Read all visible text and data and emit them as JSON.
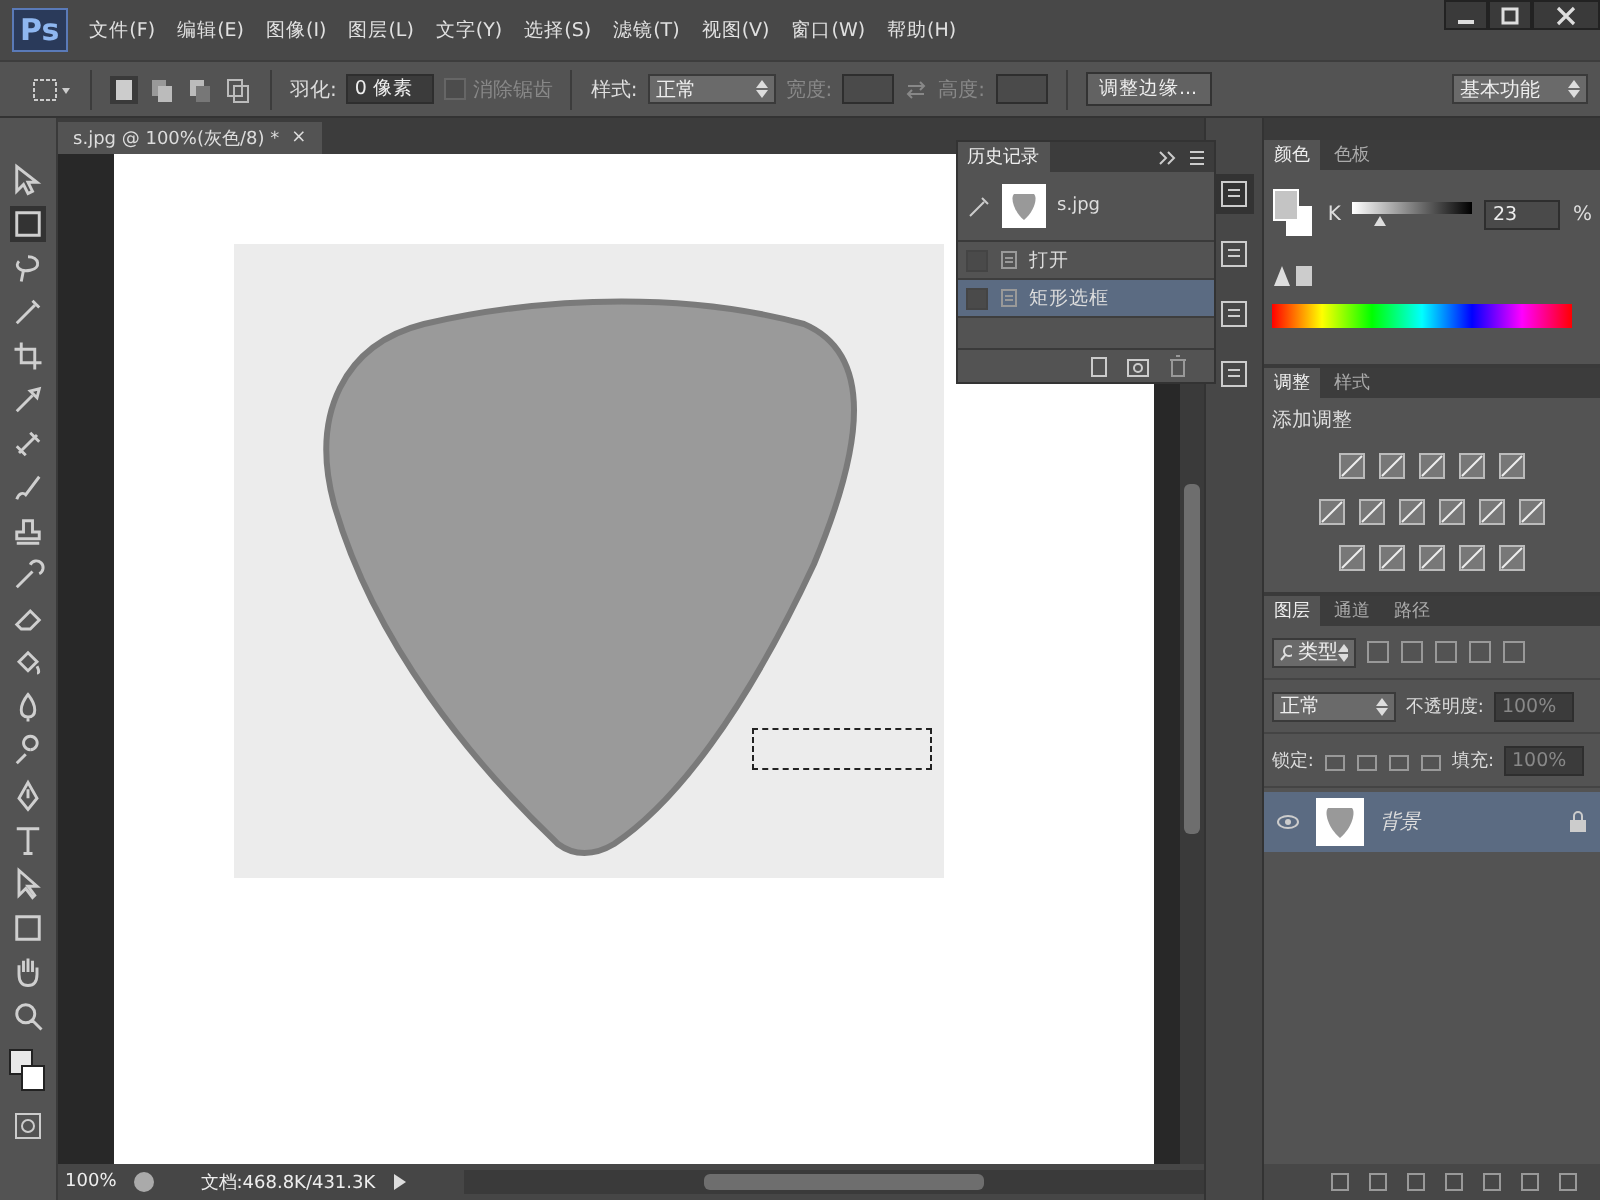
{
  "app": {
    "logo": "Ps"
  },
  "menu": [
    "文件(F)",
    "编辑(E)",
    "图像(I)",
    "图层(L)",
    "文字(Y)",
    "选择(S)",
    "滤镜(T)",
    "视图(V)",
    "窗口(W)",
    "帮助(H)"
  ],
  "options_bar": {
    "feather_label": "羽化:",
    "feather_value": "0 像素",
    "antialias": {
      "label": "消除锯齿",
      "disabled": true
    },
    "style_label": "样式:",
    "style_value": "正常",
    "width_label": "宽度:",
    "height_label": "高度:",
    "refine_button": "调整边缘...",
    "workspace": "基本功能"
  },
  "document_tab": {
    "title": "s.jpg @ 100%(灰色/8) *",
    "close": "×"
  },
  "history_panel": {
    "title": "历史记录",
    "snapshot": "s.jpg",
    "items": [
      {
        "label": "打开",
        "selected": false
      },
      {
        "label": "矩形选框",
        "selected": true
      }
    ]
  },
  "color_panel": {
    "tabs": [
      {
        "label": "颜色",
        "selected": true
      },
      {
        "label": "色板",
        "selected": false
      }
    ],
    "channel": "K",
    "level": 0.23,
    "value": "23",
    "unit": "%"
  },
  "adjustments_panel": {
    "tabs": [
      {
        "label": "调整",
        "selected": true
      },
      {
        "label": "样式",
        "selected": false
      }
    ],
    "heading": "添加调整"
  },
  "layers_panel": {
    "tabs": [
      {
        "label": "图层",
        "selected": true
      },
      {
        "label": "通道",
        "selected": false
      },
      {
        "label": "路径",
        "selected": false
      }
    ],
    "filter": "类型",
    "blend_mode": "正常",
    "opacity_label": "不透明度:",
    "opacity_value": "100%",
    "lock_label": "锁定:",
    "fill_label": "填充:",
    "fill_value": "100%",
    "layers": [
      {
        "name": "背景",
        "selected": true
      }
    ]
  },
  "status_bar": {
    "zoom": "100%",
    "doc_info": "文档:468.8K/431.3K"
  }
}
